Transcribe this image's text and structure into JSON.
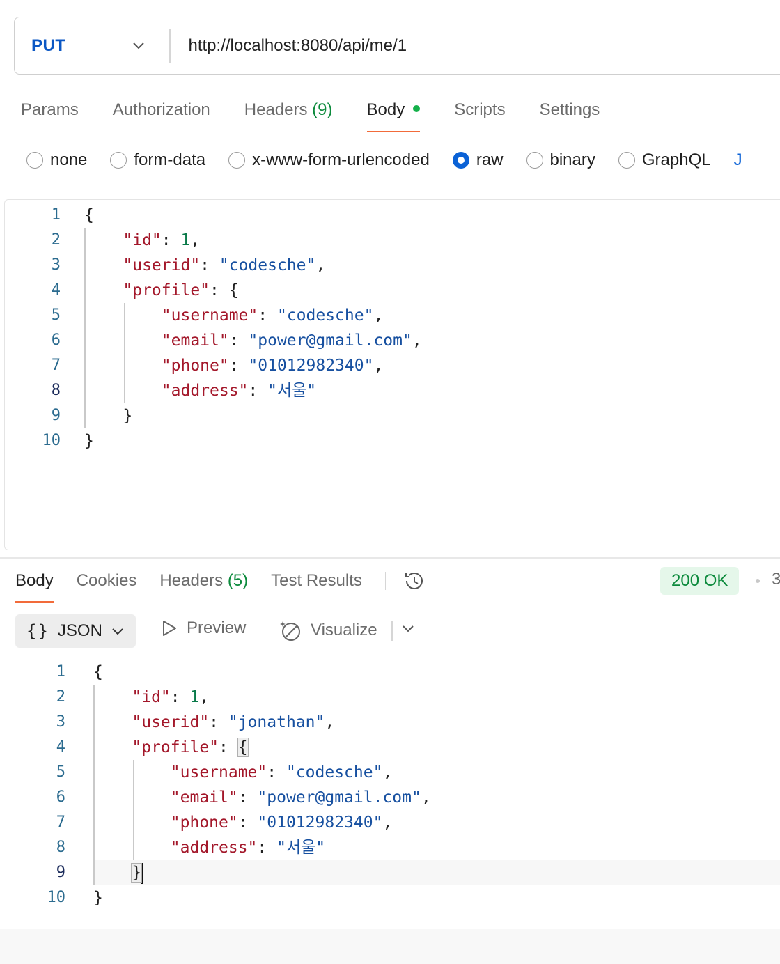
{
  "request": {
    "method": "PUT",
    "url": "http://localhost:8080/api/me/1",
    "tabs": [
      {
        "label": "Params",
        "count": ""
      },
      {
        "label": "Authorization",
        "count": ""
      },
      {
        "label": "Headers",
        "count": "(9)"
      },
      {
        "label": "Body",
        "count": "",
        "active": true
      },
      {
        "label": "Scripts",
        "count": ""
      },
      {
        "label": "Settings",
        "count": ""
      }
    ],
    "body_types": [
      "none",
      "form-data",
      "x-www-form-urlencoded",
      "raw",
      "binary",
      "GraphQL"
    ],
    "body_type_selected": "raw",
    "body_type_overflow": "J",
    "line_numbers": [
      "1",
      "2",
      "3",
      "4",
      "5",
      "6",
      "7",
      "8",
      "9",
      "10"
    ],
    "body_json": {
      "id": "1",
      "userid": "\"codesche\"",
      "username": "\"codesche\"",
      "email": "\"power@gmail.com\"",
      "phone": "\"01012982340\"",
      "address": "\"서울\""
    }
  },
  "response": {
    "tabs": [
      {
        "label": "Body",
        "count": "",
        "active": true
      },
      {
        "label": "Cookies",
        "count": ""
      },
      {
        "label": "Headers",
        "count": "(5)"
      },
      {
        "label": "Test Results",
        "count": ""
      }
    ],
    "status": "200 OK",
    "status_more": "3",
    "format": "JSON",
    "format_braces": "{}",
    "preview_label": "Preview",
    "visualize_label": "Visualize",
    "line_numbers": [
      "1",
      "2",
      "3",
      "4",
      "5",
      "6",
      "7",
      "8",
      "9",
      "10"
    ],
    "body_json": {
      "id": "1",
      "userid": "\"jonathan\"",
      "username": "\"codesche\"",
      "email": "\"power@gmail.com\"",
      "phone": "\"01012982340\"",
      "address": "\"서울\""
    }
  },
  "colors": {
    "method": "#0b57c4",
    "accent_underline": "#f26b3a",
    "count_green": "#0c8a3c",
    "radio_selected": "#0b62d6",
    "json_key": "#a3172a",
    "json_string": "#1750a0",
    "json_number": "#0a7a4a",
    "status_bg": "#e5f7ea"
  },
  "icons": [
    "chevron-down-icon",
    "history-icon",
    "play-icon",
    "visualize-icon"
  ]
}
